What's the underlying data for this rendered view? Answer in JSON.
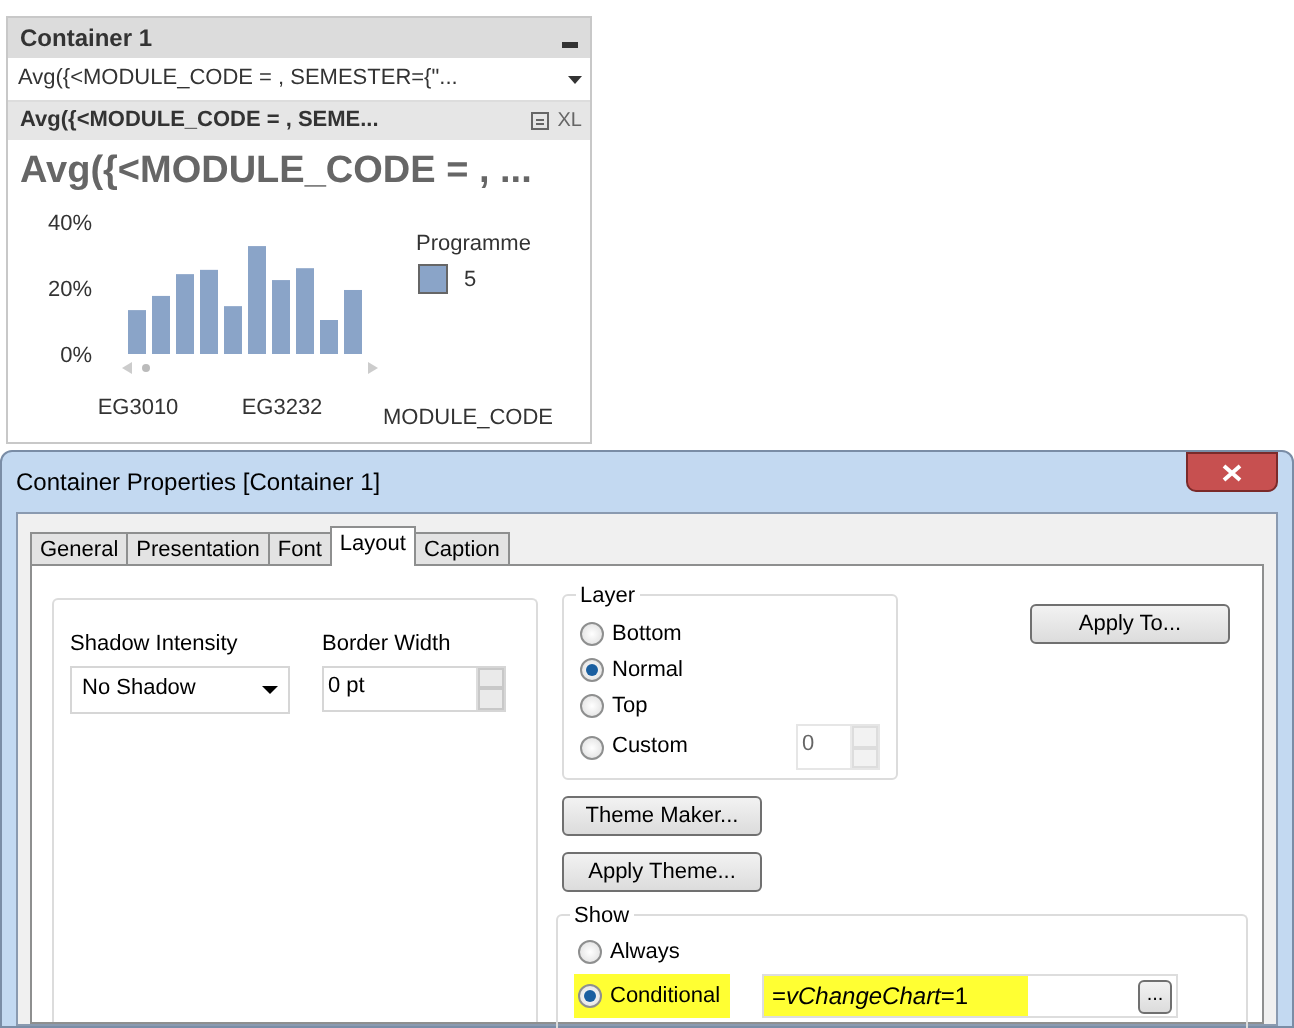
{
  "container": {
    "title": "Container 1",
    "dropdown_value": "Avg({<MODULE_CODE = , SEMESTER={\"...",
    "caption": "Avg({<MODULE_CODE = , SEME...",
    "caption_export": "XL",
    "chart_title": "Avg({<MODULE_CODE = , ...",
    "legend_title": "Programme",
    "chart_data": {
      "type": "bar",
      "xlabel": "MODULE_CODE",
      "ylim": [
        0,
        40
      ],
      "yticks": [
        {
          "value": 0,
          "label": "0%"
        },
        {
          "value": 20,
          "label": "20%"
        },
        {
          "value": 40,
          "label": "40%"
        }
      ],
      "categories": [
        "EG3010",
        null,
        null,
        null,
        null,
        null,
        "EG3232",
        null,
        null,
        null
      ],
      "series": [
        {
          "name": "5",
          "color": "#8aa4c8",
          "values": [
            13.3,
            17.6,
            24.2,
            25.5,
            14.5,
            32.7,
            22.4,
            26,
            10.3,
            19.4
          ]
        }
      ]
    }
  },
  "dialog": {
    "title": "Container Properties [Container 1]",
    "tabs": [
      {
        "label": "General",
        "selected": false
      },
      {
        "label": "Presentation",
        "selected": false
      },
      {
        "label": "Font",
        "selected": false
      },
      {
        "label": "Layout",
        "selected": true
      },
      {
        "label": "Caption",
        "selected": false
      }
    ],
    "shadow_intensity": {
      "label": "Shadow Intensity",
      "value": "No Shadow"
    },
    "border_width": {
      "label": "Border Width",
      "value": "0 pt"
    },
    "layer": {
      "label": "Layer",
      "options": [
        {
          "label": "Bottom",
          "selected": false
        },
        {
          "label": "Normal",
          "selected": true
        },
        {
          "label": "Top",
          "selected": false
        },
        {
          "label": "Custom",
          "selected": false
        }
      ],
      "custom_value": "0"
    },
    "apply_to": "Apply To...",
    "theme_maker": "Theme Maker...",
    "apply_theme": "Apply Theme...",
    "show": {
      "label": "Show",
      "options": [
        {
          "label": "Always",
          "selected": false,
          "highlighted": false
        },
        {
          "label": "Conditional",
          "selected": true,
          "highlighted": true
        }
      ],
      "condition": "=*vChangeChart*=1",
      "condition_highlighted": true,
      "browse": "..."
    }
  }
}
